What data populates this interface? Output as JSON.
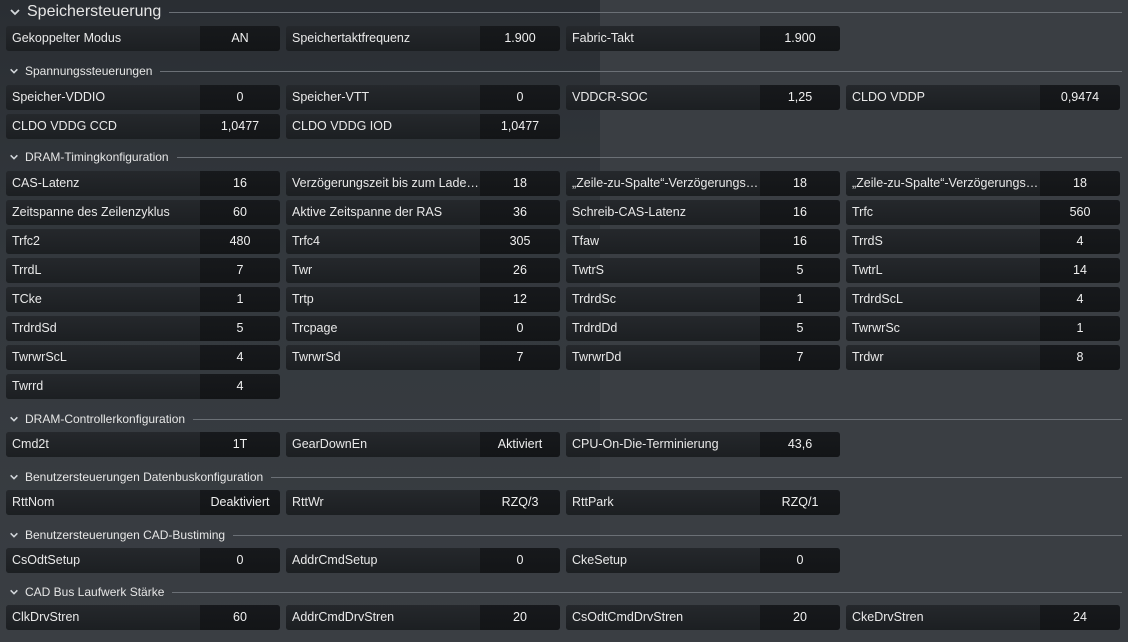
{
  "sections": {
    "speicher": {
      "title": "Speichersteuerung",
      "cells": [
        {
          "label": "Gekoppelter Modus",
          "value": "AN"
        },
        {
          "label": "Speichertaktfrequenz",
          "value": "1.900"
        },
        {
          "label": "Fabric-Takt",
          "value": "1.900"
        }
      ]
    },
    "spannung": {
      "title": "Spannungssteuerungen",
      "cells": [
        {
          "label": "Speicher-VDDIO",
          "value": "0"
        },
        {
          "label": "Speicher-VTT",
          "value": "0"
        },
        {
          "label": "VDDCR-SOC",
          "value": "1,25"
        },
        {
          "label": "CLDO VDDP",
          "value": "0,9474"
        },
        {
          "label": "CLDO VDDG CCD",
          "value": "1,0477"
        },
        {
          "label": "CLDO VDDG IOD",
          "value": "1,0477"
        }
      ]
    },
    "timing": {
      "title": "DRAM-Timingkonfiguration",
      "cells": [
        {
          "label": "CAS-Latenz",
          "value": "16"
        },
        {
          "label": "Verzögerungszeit bis zum Laden ...",
          "value": "18"
        },
        {
          "label": "„Zeile-zu-Spalte“-Verzögerungsze...",
          "value": "18"
        },
        {
          "label": "„Zeile-zu-Spalte“-Verzögerungsze...",
          "value": "18"
        },
        {
          "label": "Zeitspanne des Zeilenzyklus",
          "value": "60"
        },
        {
          "label": "Aktive Zeitspanne der RAS",
          "value": "36"
        },
        {
          "label": "Schreib-CAS-Latenz",
          "value": "16"
        },
        {
          "label": "Trfc",
          "value": "560"
        },
        {
          "label": "Trfc2",
          "value": "480"
        },
        {
          "label": "Trfc4",
          "value": "305"
        },
        {
          "label": "Tfaw",
          "value": "16"
        },
        {
          "label": "TrrdS",
          "value": "4"
        },
        {
          "label": "TrrdL",
          "value": "7"
        },
        {
          "label": "Twr",
          "value": "26"
        },
        {
          "label": "TwtrS",
          "value": "5"
        },
        {
          "label": "TwtrL",
          "value": "14"
        },
        {
          "label": "TCke",
          "value": "1"
        },
        {
          "label": "Trtp",
          "value": "12"
        },
        {
          "label": "TrdrdSc",
          "value": "1"
        },
        {
          "label": "TrdrdScL",
          "value": "4"
        },
        {
          "label": "TrdrdSd",
          "value": "5"
        },
        {
          "label": "Trcpage",
          "value": "0"
        },
        {
          "label": "TrdrdDd",
          "value": "5"
        },
        {
          "label": "TwrwrSc",
          "value": "1"
        },
        {
          "label": "TwrwrScL",
          "value": "4"
        },
        {
          "label": "TwrwrSd",
          "value": "7"
        },
        {
          "label": "TwrwrDd",
          "value": "7"
        },
        {
          "label": "Trdwr",
          "value": "8"
        },
        {
          "label": "Twrrd",
          "value": "4"
        }
      ]
    },
    "controller": {
      "title": "DRAM-Controllerkonfiguration",
      "cells": [
        {
          "label": "Cmd2t",
          "value": "1T"
        },
        {
          "label": "GearDownEn",
          "value": "Aktiviert"
        },
        {
          "label": "CPU-On-Die-Terminierung",
          "value": "43,6"
        }
      ]
    },
    "datenbus": {
      "title": "Benutzersteuerungen Datenbuskonfiguration",
      "cells": [
        {
          "label": "RttNom",
          "value": "Deaktiviert"
        },
        {
          "label": "RttWr",
          "value": "RZQ/3"
        },
        {
          "label": "RttPark",
          "value": "RZQ/1"
        }
      ]
    },
    "cadtiming": {
      "title": "Benutzersteuerungen CAD-Bustiming",
      "cells": [
        {
          "label": "CsOdtSetup",
          "value": "0"
        },
        {
          "label": "AddrCmdSetup",
          "value": "0"
        },
        {
          "label": "CkeSetup",
          "value": "0"
        }
      ]
    },
    "cadstaerke": {
      "title": "CAD Bus Laufwerk Stärke",
      "cells": [
        {
          "label": "ClkDrvStren",
          "value": "60"
        },
        {
          "label": "AddrCmdDrvStren",
          "value": "20"
        },
        {
          "label": "CsOdtCmdDrvStren",
          "value": "20"
        },
        {
          "label": "CkeDrvStren",
          "value": "24"
        }
      ]
    }
  },
  "icons": {
    "collapse": "chevron-down-icon"
  }
}
